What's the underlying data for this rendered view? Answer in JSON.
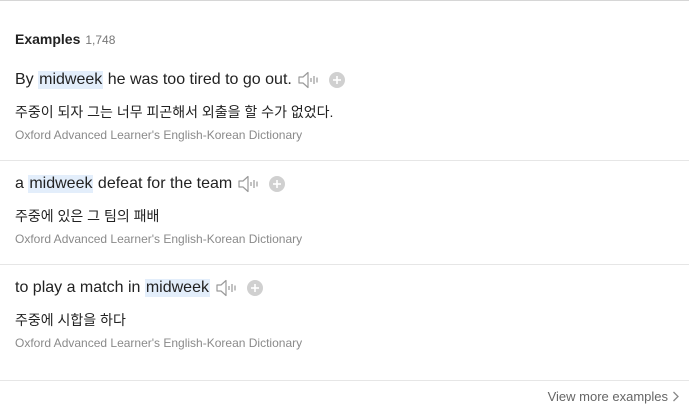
{
  "header": {
    "title": "Examples",
    "count": "1,748"
  },
  "examples": [
    {
      "before": "By ",
      "highlight": "midweek",
      "after": " he was too tired to go out.",
      "translation": "주중이 되자 그는 너무 피곤해서 외출을 할 수가 없었다.",
      "source": "Oxford Advanced Learner's English-Korean Dictionary"
    },
    {
      "before": "a ",
      "highlight": "midweek",
      "after": " defeat for the team",
      "translation": "주중에 있은 그 팀의 패배",
      "source": "Oxford Advanced Learner's English-Korean Dictionary"
    },
    {
      "before": "to play a match in ",
      "highlight": "midweek",
      "after": "",
      "translation": "주중에 시합을 하다",
      "source": "Oxford Advanced Learner's English-Korean Dictionary"
    }
  ],
  "footer": {
    "view_more_label": "View more examples"
  },
  "icons": {
    "sound": "speaker-icon",
    "add": "plus-circle-icon",
    "more": "chevron-right-icon"
  },
  "colors": {
    "highlight_bg": "#e3eefb",
    "text": "#222222",
    "muted": "#8a8a8a",
    "icon": "#9a9a9a",
    "add_circle": "#d0d0d0"
  }
}
